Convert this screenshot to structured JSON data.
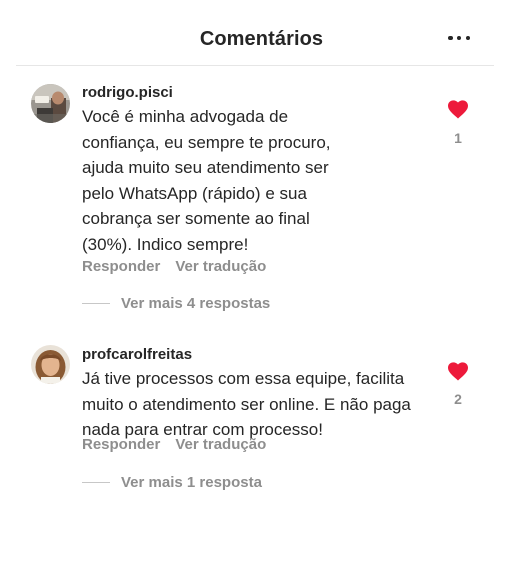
{
  "header": {
    "title": "Comentários",
    "more_icon": "more-horizontal-icon"
  },
  "comments": [
    {
      "username": "rodrigo.pisci",
      "lines": [
        "Você é minha advogada de",
        "confiança, eu sempre te procuro,",
        "ajuda muito seu atendimento ser",
        "pelo WhatsApp (rápido) e sua",
        "cobrança ser somente ao final",
        "(30%). Indico sempre!"
      ],
      "reply_label": "Responder",
      "translate_label": "Ver tradução",
      "view_replies_label": "Ver mais 4 respostas",
      "likes": "1",
      "liked": true
    },
    {
      "username": "profcarolfreitas",
      "lines": [
        "Já tive processos com essa equipe, facilita",
        "muito o atendimento ser online. E não paga",
        "nada para entrar com processo!"
      ],
      "reply_label": "Responder",
      "translate_label": "Ver tradução",
      "view_replies_label": "Ver mais 1 resposta",
      "likes": "2",
      "liked": true
    }
  ],
  "colors": {
    "heart": "#ed1a3b",
    "text": "#262626",
    "secondary": "#8e8e8e"
  }
}
